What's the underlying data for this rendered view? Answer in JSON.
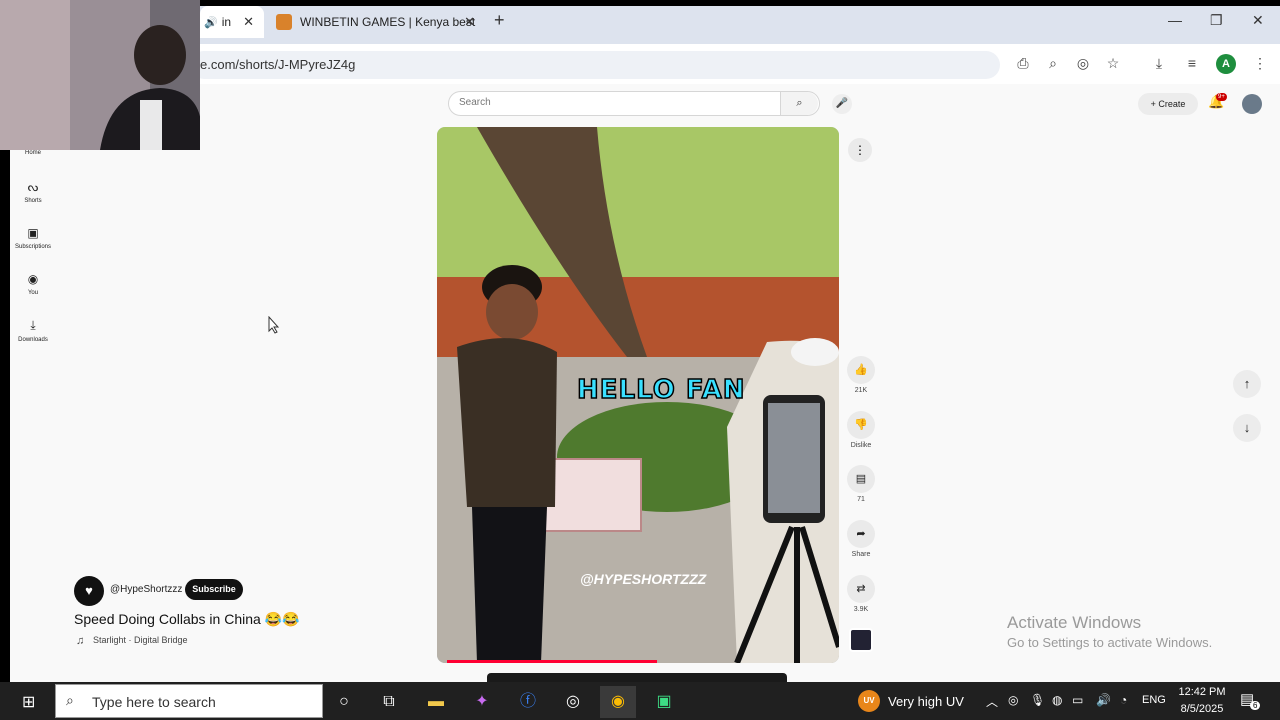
{
  "browser": {
    "tabs": [
      {
        "label": "in"
      },
      {
        "label": "WINBETIN GAMES | Kenya best"
      }
    ],
    "url": "e.com/shorts/J-MPyreJZ4g",
    "profile_letter": "A"
  },
  "youtube": {
    "search_placeholder": "Search",
    "create_label": "Create",
    "notification_count": "9+",
    "sidebar": [
      {
        "label": "Home",
        "icon": "home-icon"
      },
      {
        "label": "Shorts",
        "icon": "shorts-icon"
      },
      {
        "label": "Subscriptions",
        "icon": "subscriptions-icon"
      },
      {
        "label": "You",
        "icon": "you-icon"
      },
      {
        "label": "Downloads",
        "icon": "downloads-icon"
      }
    ],
    "short": {
      "caption_overlay": "HELLO FAN",
      "watermark": "@HYPESHORTZZZ",
      "channel": "@HypeShortzzz",
      "subscribe_label": "Subscribe",
      "title": "Speed Doing Collabs in China 😂😂",
      "music": "Starlight · Digital Bridge",
      "progress": 0.55
    },
    "actions": {
      "likes": "21K",
      "dislike_label": "Dislike",
      "comments": "71",
      "share_label": "Share",
      "remix_count": "3.9K"
    }
  },
  "watermark": {
    "line1": "Activate Windows",
    "line2": "Go to Settings to activate Windows."
  },
  "taskbar": {
    "search_placeholder": "Type here to search",
    "weather_badge": "UV",
    "weather": "Very high UV",
    "language": "ENG",
    "time": "12:42 PM",
    "date": "8/5/2025",
    "notifications": "6"
  },
  "colors": {
    "accent_red": "#ff0033",
    "caption_cyan": "#39e0ff",
    "taskbar": "#202020"
  }
}
